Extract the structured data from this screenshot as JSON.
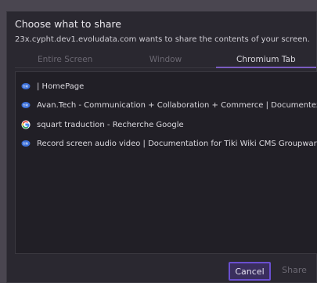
{
  "dialog": {
    "title": "Choose what to share",
    "subtitle": "23x.cypht.dev1.evoludata.com wants to share the contents of your screen."
  },
  "tabs": [
    {
      "label": "Entire Screen",
      "active": false
    },
    {
      "label": "Window",
      "active": false
    },
    {
      "label": "Chromium Tab",
      "active": true
    }
  ],
  "tab_items": [
    {
      "label": "| HomePage",
      "icon": "tiki-favicon-icon"
    },
    {
      "label": "Avan.Tech - Communication + Collaboration + Commerce | Documentez la nouv",
      "icon": "tiki-favicon-icon"
    },
    {
      "label": "squart traduction - Recherche Google",
      "icon": "google-favicon-icon"
    },
    {
      "label": "Record screen audio video | Documentation for Tiki Wiki CMS Groupware",
      "icon": "tiki-favicon-icon"
    }
  ],
  "buttons": {
    "cancel": "Cancel",
    "share": "Share"
  },
  "colors": {
    "accent": "#6a4fd0",
    "background": "#2a2830"
  }
}
